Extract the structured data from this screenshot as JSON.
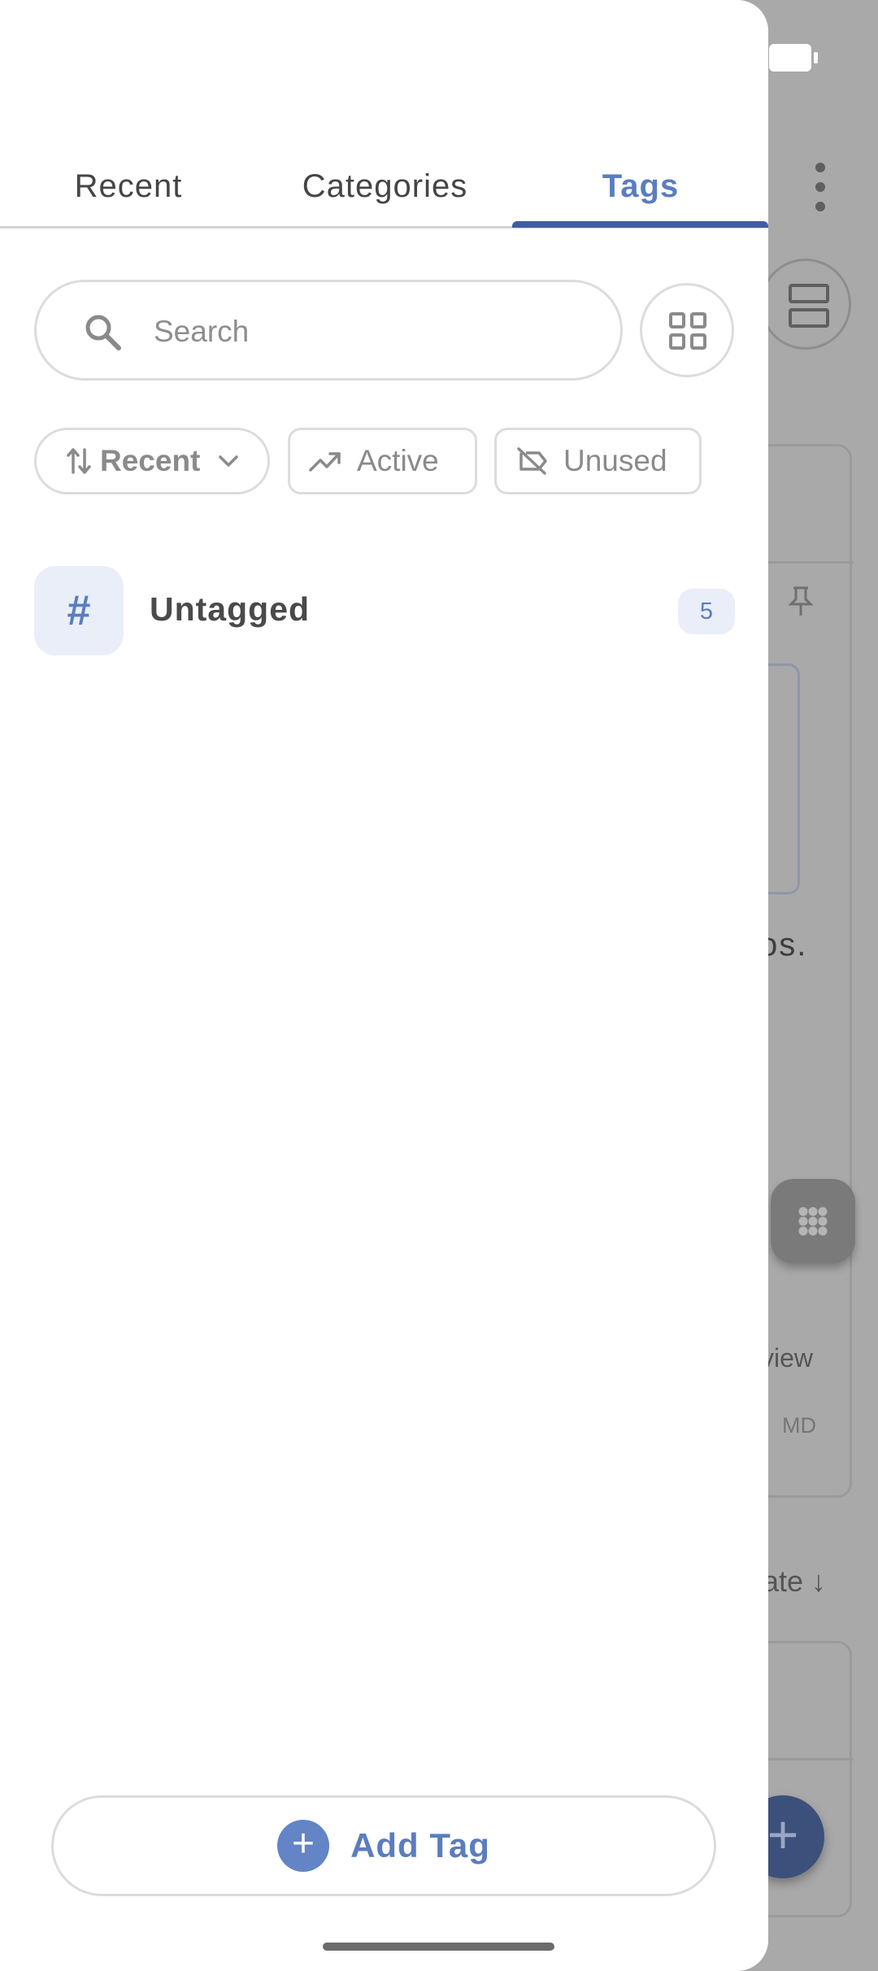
{
  "tabs": [
    {
      "label": "Recent"
    },
    {
      "label": "Categories"
    },
    {
      "label": "Tags",
      "selected": true
    }
  ],
  "search": {
    "placeholder": "Search"
  },
  "filters": {
    "sort_label": "Recent",
    "active_label": "Active",
    "unused_label": "Unused"
  },
  "tags": [
    {
      "symbol": "#",
      "name": "Untagged",
      "count": "5"
    }
  ],
  "add_tag_label": "Add Tag",
  "background": {
    "fragment_ps": "os.",
    "fragment_view": "view",
    "fragment_md": "MD",
    "fragment_date": "late ↓"
  },
  "colors": {
    "accent": "#5b7dbf",
    "indicator": "#3e5e9e",
    "scrim": "#a9a9a9"
  }
}
